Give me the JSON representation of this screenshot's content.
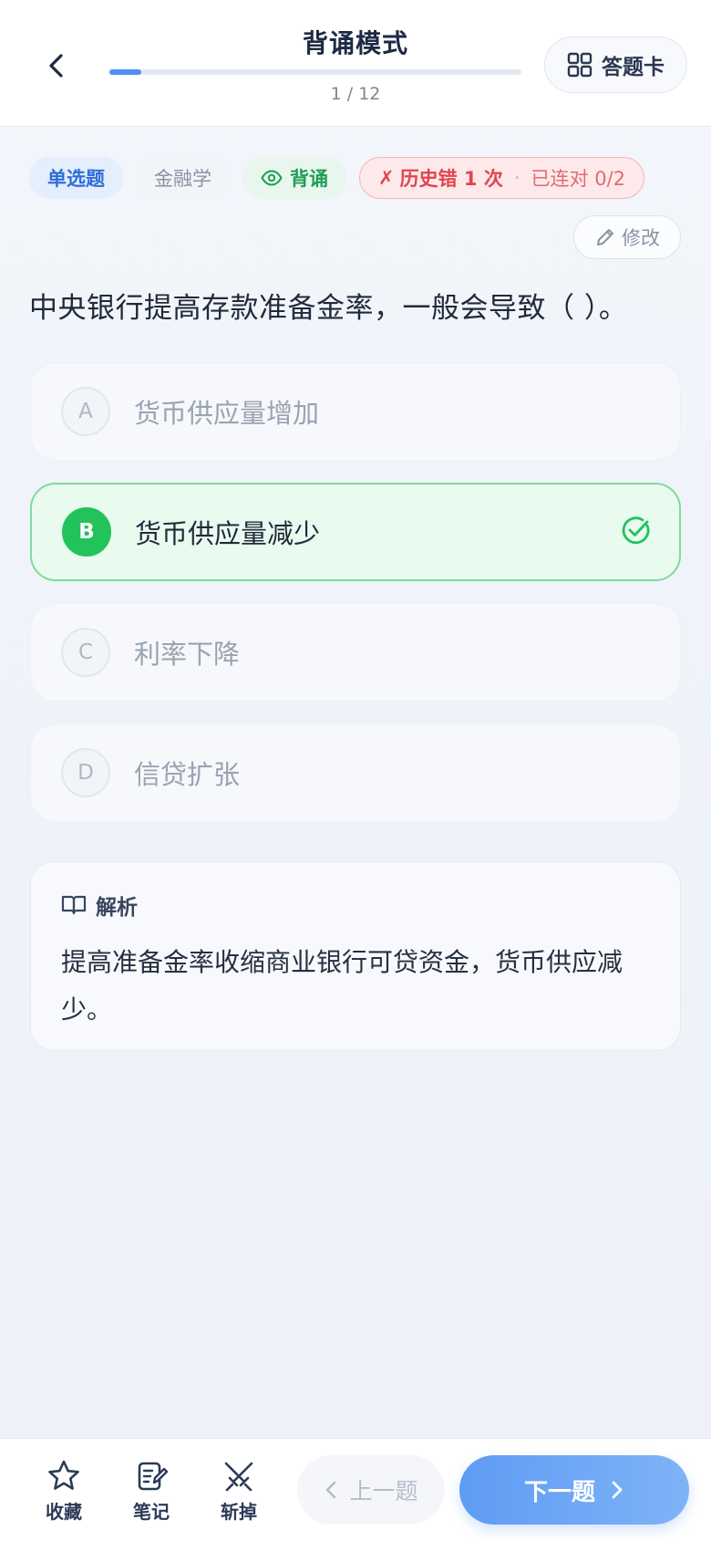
{
  "header": {
    "title": "背诵模式",
    "progress_text": "1 / 12",
    "progress_fraction": 0.077,
    "card_button_label": "答题卡"
  },
  "tags": {
    "type": "单选题",
    "subject": "金融学",
    "mode": "背诵",
    "history_mark": "✗",
    "history_wrong": "历史错 1 次",
    "history_separator": "·",
    "history_streak": "已连对 0/2"
  },
  "edit_label": "修改",
  "question": "中央银行提高存款准备金率，一般会导致（ ）。",
  "options": [
    {
      "letter": "A",
      "text": "货币供应量增加"
    },
    {
      "letter": "B",
      "text": "货币供应量减少"
    },
    {
      "letter": "C",
      "text": "利率下降"
    },
    {
      "letter": "D",
      "text": "信贷扩张"
    }
  ],
  "analysis": {
    "heading": "解析",
    "body": "提高准备金率收缩商业银行可贷资金，货币供应减少。"
  },
  "bottom": {
    "favorite": "收藏",
    "note": "笔记",
    "remove": "斩掉",
    "prev": "上一题",
    "next": "下一题"
  },
  "colors": {
    "accent": "#4f8ff2",
    "correct": "#22c35a",
    "error": "#e0454d"
  }
}
